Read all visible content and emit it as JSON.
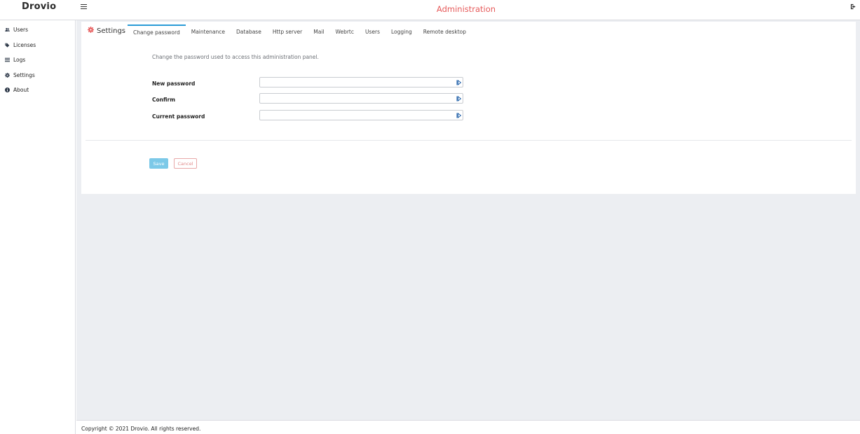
{
  "brand": {
    "logo_text": "Drovio"
  },
  "header": {
    "title": "Administration",
    "title_color": "#e65a5a",
    "menu_icon": "hamburger-icon",
    "logout_icon": "logout-icon"
  },
  "sidebar": {
    "items": [
      {
        "label": "Users",
        "icon": "users-icon"
      },
      {
        "label": "Licenses",
        "icon": "tags-icon"
      },
      {
        "label": "Logs",
        "icon": "list-icon"
      },
      {
        "label": "Settings",
        "icon": "gear-icon"
      },
      {
        "label": "About",
        "icon": "info-icon"
      }
    ]
  },
  "settings": {
    "title": "Settings",
    "title_icon": "gear-icon",
    "tabs": [
      {
        "label": "Change password",
        "active": true
      },
      {
        "label": "Maintenance"
      },
      {
        "label": "Database"
      },
      {
        "label": "Http server"
      },
      {
        "label": "Mail"
      },
      {
        "label": "Webrtc"
      },
      {
        "label": "Users"
      },
      {
        "label": "Logging"
      },
      {
        "label": "Remote desktop"
      }
    ],
    "description": "Change the password used to access this administration panel.",
    "fields": [
      {
        "label": "New password",
        "value": ""
      },
      {
        "label": "Confirm",
        "value": ""
      },
      {
        "label": "Current password",
        "value": ""
      }
    ],
    "buttons": {
      "save": "Save",
      "cancel": "Cancel"
    }
  },
  "footer": {
    "copyright": "Copyright © 2021 Drovio. All rights reserved."
  },
  "colors": {
    "accent": "#2a9bd6",
    "save_button": "#7cc9e8",
    "cancel_text": "#e08b8b",
    "background": "#eceef2"
  }
}
